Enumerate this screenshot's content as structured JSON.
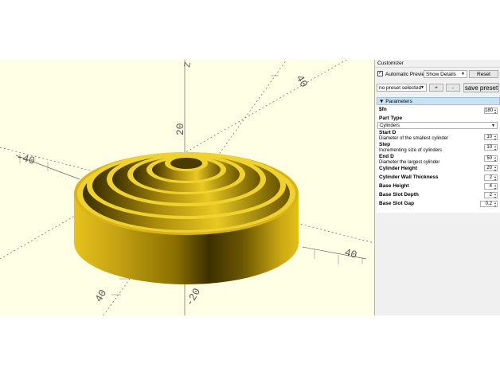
{
  "viewport": {
    "axis_labels": [
      "40",
      "40",
      "-40",
      "40",
      "20",
      "-20"
    ]
  },
  "customizer": {
    "title": "Customizer",
    "automatic_preview_label": "Automatic Preview",
    "automatic_preview_checked": true,
    "show_details_value": "Show Details",
    "reset_label": "Reset",
    "preset_value": "no preset selected",
    "add_label": "+",
    "remove_label": "-",
    "save_preset_label": "save preset",
    "section_title": "Parameters",
    "params": [
      {
        "label": "$fn",
        "value": "180"
      },
      {
        "label": "Part Type",
        "value": "Cylinders"
      },
      {
        "label": "Start D",
        "description": "Diameter of the smallest cylinder",
        "value": "10"
      },
      {
        "label": "Step",
        "description": "Incrementing size of cylinders",
        "value": "10"
      },
      {
        "label": "End D",
        "description": "Diameter the largest cylinder",
        "value": "50"
      },
      {
        "label": "Cylinder Height",
        "value": "20"
      },
      {
        "label": "Cylinder Wall Thickness",
        "value": "2"
      },
      {
        "label": "Base Height",
        "value": "4"
      },
      {
        "label": "Base Slot Depth",
        "value": "2"
      },
      {
        "label": "Base Slot Gap",
        "value": "0.2"
      }
    ]
  }
}
